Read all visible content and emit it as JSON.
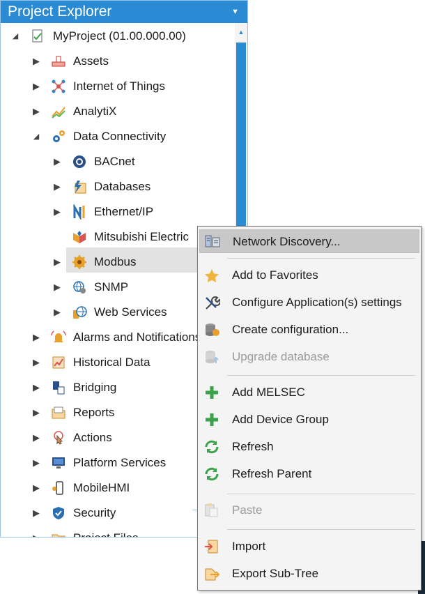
{
  "panel": {
    "title": "Project Explorer"
  },
  "tree": [
    {
      "label": "MyProject (01.00.000.00)",
      "depth": 0,
      "expanded": true,
      "icon": "project-icon"
    },
    {
      "label": "Assets",
      "depth": 1,
      "expanded": false,
      "icon": "assets-icon"
    },
    {
      "label": "Internet of Things",
      "depth": 1,
      "expanded": false,
      "icon": "iot-icon"
    },
    {
      "label": "AnalytiX",
      "depth": 1,
      "expanded": false,
      "icon": "analytix-icon"
    },
    {
      "label": "Data Connectivity",
      "depth": 1,
      "expanded": true,
      "icon": "gears-icon"
    },
    {
      "label": "BACnet",
      "depth": 2,
      "expanded": false,
      "icon": "bacnet-icon"
    },
    {
      "label": "Databases",
      "depth": 2,
      "expanded": false,
      "icon": "databases-icon"
    },
    {
      "label": "Ethernet/IP",
      "depth": 2,
      "expanded": false,
      "icon": "ethernet-icon"
    },
    {
      "label": "Mitsubishi Electric",
      "depth": 2,
      "expanded": null,
      "icon": "mitsubishi-icon",
      "selected": true
    },
    {
      "label": "Modbus",
      "depth": 2,
      "expanded": false,
      "icon": "modbus-icon"
    },
    {
      "label": "SNMP",
      "depth": 2,
      "expanded": false,
      "icon": "snmp-icon"
    },
    {
      "label": "Web Services",
      "depth": 2,
      "expanded": false,
      "icon": "web-services-icon"
    },
    {
      "label": "Alarms and Notifications",
      "depth": 1,
      "expanded": false,
      "icon": "alarm-icon"
    },
    {
      "label": "Historical Data",
      "depth": 1,
      "expanded": false,
      "icon": "historical-icon"
    },
    {
      "label": "Bridging",
      "depth": 1,
      "expanded": false,
      "icon": "bridging-icon"
    },
    {
      "label": "Reports",
      "depth": 1,
      "expanded": false,
      "icon": "reports-icon"
    },
    {
      "label": "Actions",
      "depth": 1,
      "expanded": false,
      "icon": "actions-icon"
    },
    {
      "label": "Platform Services",
      "depth": 1,
      "expanded": false,
      "icon": "platform-icon"
    },
    {
      "label": "MobileHMI",
      "depth": 1,
      "expanded": false,
      "icon": "mobile-icon"
    },
    {
      "label": "Security",
      "depth": 1,
      "expanded": false,
      "icon": "security-icon"
    },
    {
      "label": "Project Files",
      "depth": 1,
      "expanded": false,
      "icon": "files-icon"
    }
  ],
  "context_menu": {
    "items": [
      {
        "label": "Network Discovery...",
        "icon": "network-discovery-icon",
        "highlighted": true,
        "disabled": false,
        "group": 0
      },
      {
        "label": "Add to Favorites",
        "icon": "star-icon",
        "disabled": false,
        "group": 1
      },
      {
        "label": "Configure Application(s) settings",
        "icon": "wrench-icon",
        "disabled": false,
        "group": 1
      },
      {
        "label": "Create configuration...",
        "icon": "database-create-icon",
        "disabled": false,
        "group": 1
      },
      {
        "label": "Upgrade database",
        "icon": "database-upgrade-icon",
        "disabled": true,
        "group": 1
      },
      {
        "label": "Add MELSEC",
        "icon": "plus-icon",
        "disabled": false,
        "group": 2
      },
      {
        "label": "Add Device Group",
        "icon": "plus-icon",
        "disabled": false,
        "group": 2
      },
      {
        "label": "Refresh",
        "icon": "refresh-icon",
        "disabled": false,
        "group": 2
      },
      {
        "label": "Refresh Parent",
        "icon": "refresh-icon",
        "disabled": false,
        "group": 2
      },
      {
        "label": "Paste",
        "icon": "paste-icon",
        "disabled": true,
        "group": 3
      },
      {
        "label": "Import",
        "icon": "import-icon",
        "disabled": false,
        "group": 4
      },
      {
        "label": "Export Sub-Tree",
        "icon": "export-icon",
        "disabled": false,
        "group": 4
      }
    ]
  },
  "colors": {
    "accent": "#2a8ad4",
    "menu_bg": "#f4f4f4",
    "highlight": "#c8c8c8",
    "plus": "#3aa24a"
  }
}
